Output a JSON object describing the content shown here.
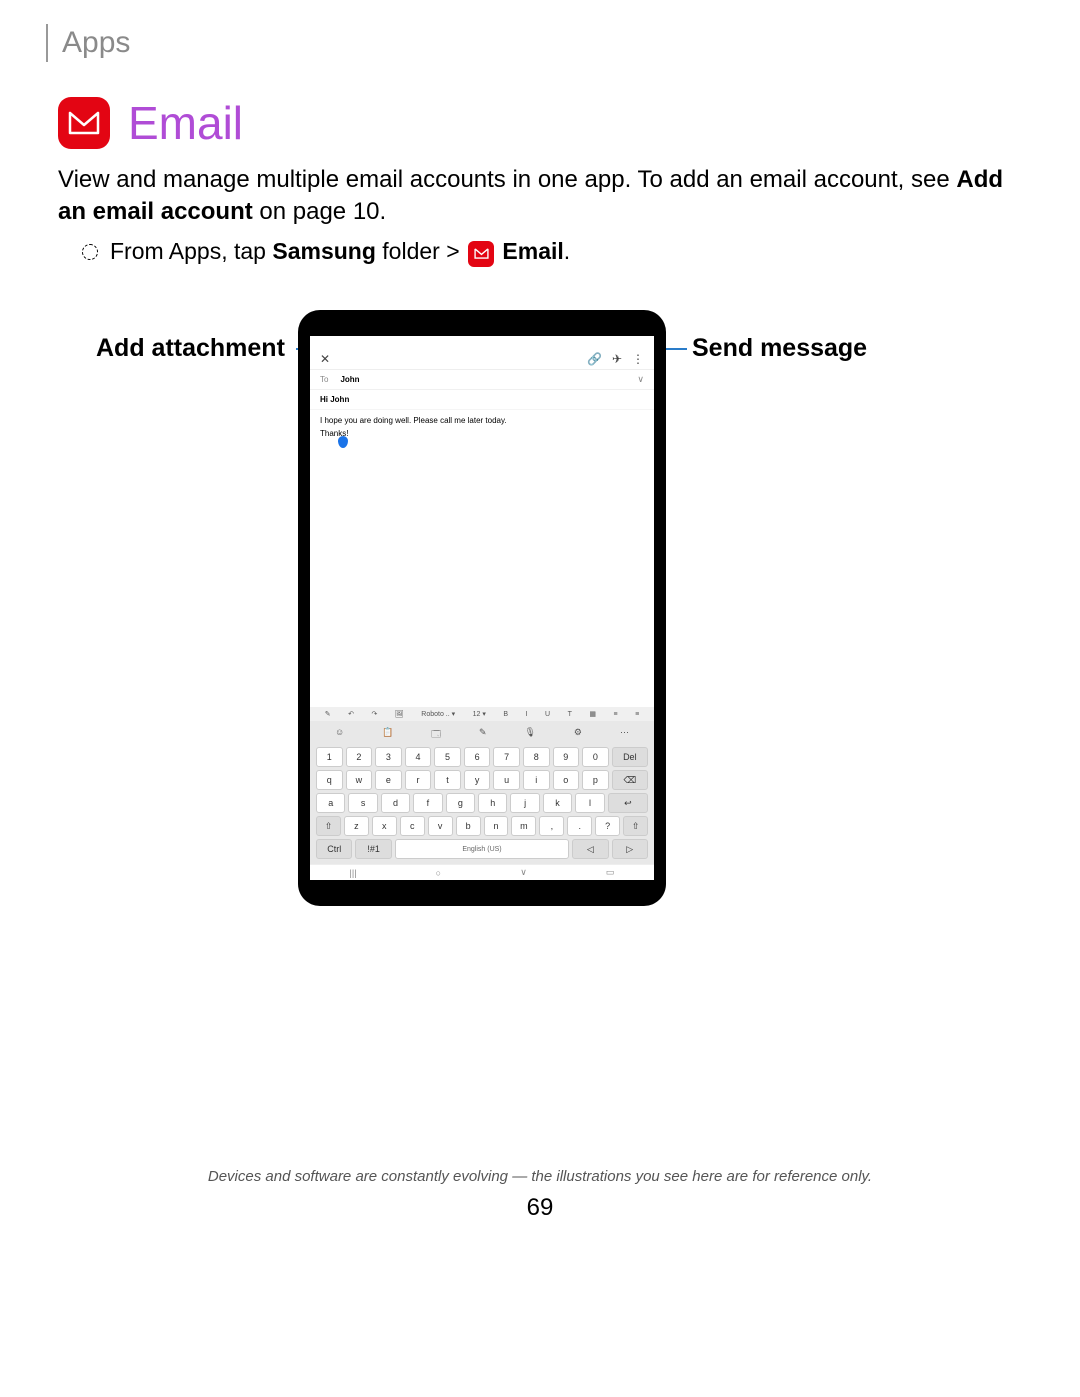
{
  "breadcrumb": "Apps",
  "section": {
    "title": "Email",
    "intro_pre": "View and manage multiple email accounts in one app. To add an email account, see ",
    "intro_bold": "Add an email account",
    "intro_post": " on page 10."
  },
  "step": {
    "pre": "From Apps, tap ",
    "samsung": "Samsung",
    "mid": " folder > ",
    "email": "Email",
    "end": "."
  },
  "callouts": {
    "left": "Add attachment",
    "right": "Send message"
  },
  "compose": {
    "to_label": "To",
    "to_name": "John",
    "subject": "Hi John",
    "body_line": "I hope you are doing well. Please call me later today.",
    "body_thanks": "Thanks!"
  },
  "format_bar": [
    "✎",
    "↶",
    "↷",
    "🖼",
    "Roboto .. ▾",
    "12 ▾",
    "B",
    "I",
    "U",
    "T",
    "▦",
    "≡",
    "≡"
  ],
  "keyboard": {
    "suggest": [
      "☺",
      "📋",
      "🗔",
      "✎",
      "🎙",
      "⚙",
      "⋯"
    ],
    "row1": [
      "1",
      "2",
      "3",
      "4",
      "5",
      "6",
      "7",
      "8",
      "9",
      "0",
      "Del"
    ],
    "row2": [
      "q",
      "w",
      "e",
      "r",
      "t",
      "y",
      "u",
      "i",
      "o",
      "p",
      "⌫"
    ],
    "row3": [
      "a",
      "s",
      "d",
      "f",
      "g",
      "h",
      "j",
      "k",
      "l",
      "↩"
    ],
    "row4": [
      "⇧",
      "z",
      "x",
      "c",
      "v",
      "b",
      "n",
      "m",
      ",",
      ".",
      "?",
      "⇧"
    ],
    "row5_ctrl": "Ctrl",
    "row5_sym": "!#1",
    "row5_space": "English (US)",
    "row5_left": "◁",
    "row5_right": "▷"
  },
  "navbar": [
    "|||",
    "○",
    "∨",
    "▭"
  ],
  "footer": "Devices and software are constantly evolving — the illustrations you see here are for reference only.",
  "page": "69"
}
